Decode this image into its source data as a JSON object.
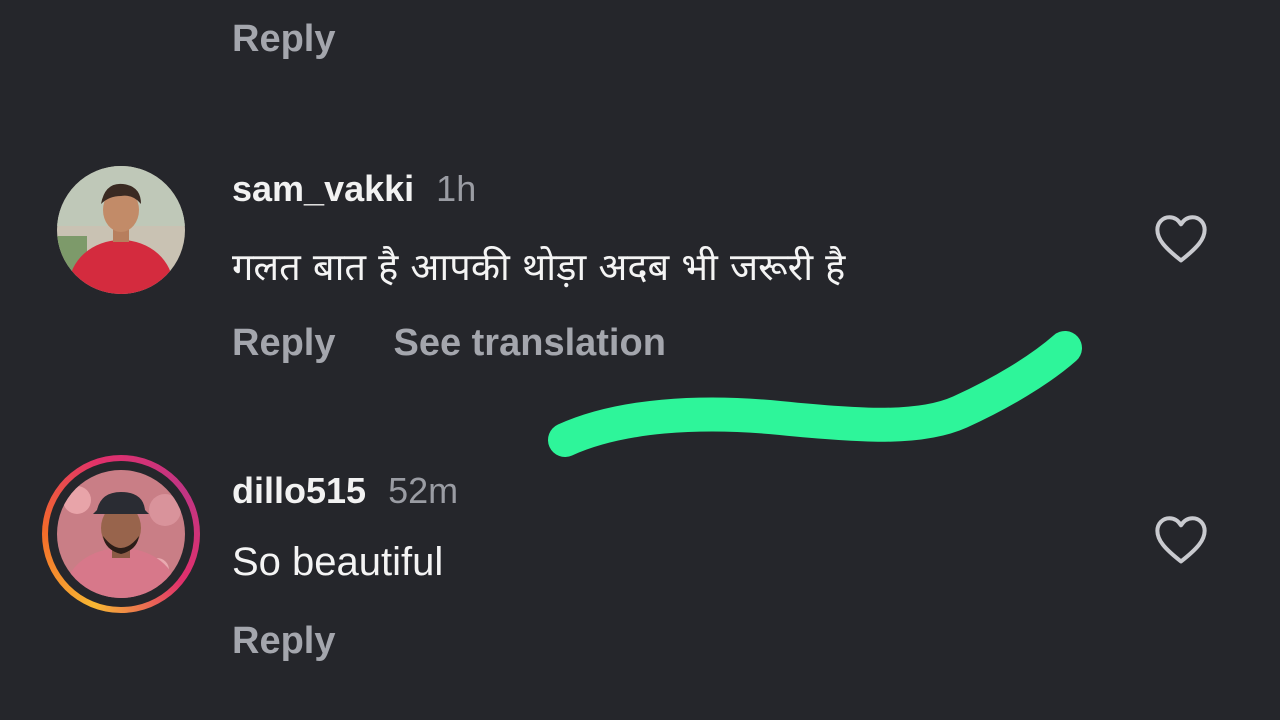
{
  "top_reply": {
    "label": "Reply"
  },
  "comments": [
    {
      "username": "sam_vakki",
      "time": "1h",
      "text": "गलत बात है आपकी थोड़ा अदब भी जरूरी है",
      "reply_label": "Reply",
      "translate_label": "See translation",
      "has_story_ring": false
    },
    {
      "username": "dillo515",
      "time": "52m",
      "text": "So beautiful",
      "reply_label": "Reply",
      "has_story_ring": true
    }
  ],
  "icons": {
    "like": "heart-outline-icon"
  },
  "colors": {
    "background": "#25262b",
    "secondary_text": "#a4a6ad",
    "highlight_marker": "#2ef59a"
  }
}
